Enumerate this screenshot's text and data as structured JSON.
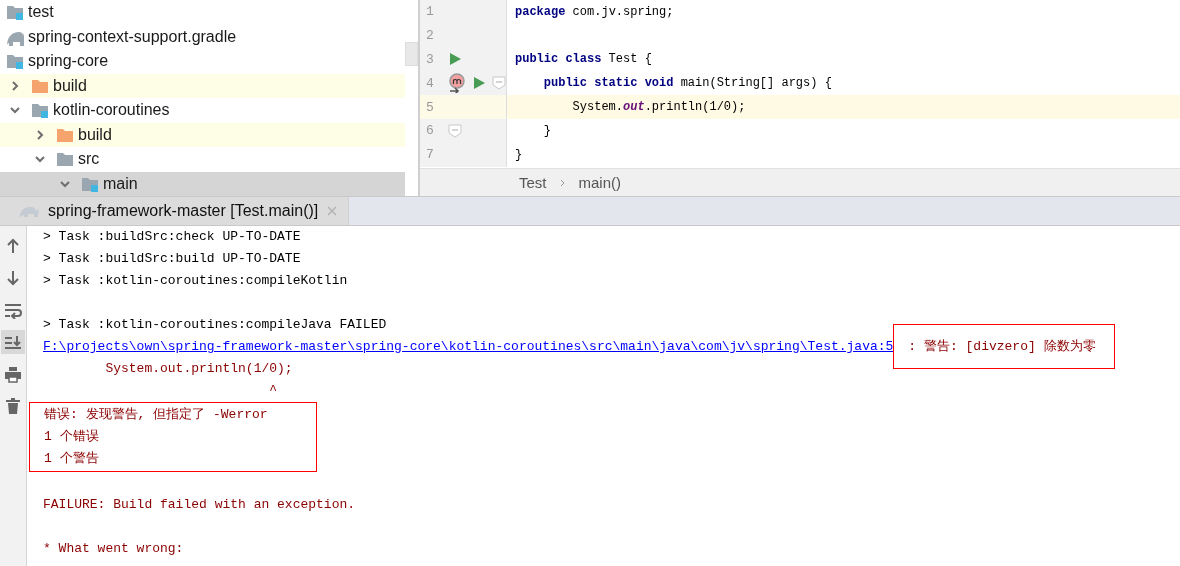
{
  "project_tree": {
    "items": [
      {
        "label": "test",
        "kind": "module"
      },
      {
        "label": "spring-context-support.gradle",
        "kind": "gradle"
      },
      {
        "label": "spring-core",
        "kind": "module",
        "children": [
          {
            "label": "build",
            "kind": "excluded",
            "expanded": false,
            "highlighted": true,
            "selected": false
          },
          {
            "label": "kotlin-coroutines",
            "kind": "module",
            "expanded": true,
            "highlighted": false,
            "selected": false,
            "children": [
              {
                "label": "build",
                "kind": "excluded",
                "expanded": false,
                "highlighted": true,
                "selected": false
              },
              {
                "label": "src",
                "kind": "folder",
                "expanded": true,
                "highlighted": false,
                "selected": false,
                "children": [
                  {
                    "label": "main",
                    "kind": "module",
                    "expanded": true,
                    "highlighted": false,
                    "selected": true
                  }
                ]
              }
            ]
          }
        ]
      }
    ]
  },
  "editor": {
    "lines": [
      {
        "number": "1",
        "code": "**package** com.jv.spring;",
        "current": false
      },
      {
        "number": "2",
        "current": false
      },
      {
        "number": "3",
        "code": "**public class** Test {",
        "current": false,
        "markers": [
          {
            "kind": "run"
          }
        ]
      },
      {
        "number": "4",
        "code": "    **public static void** main(String[] args) {",
        "current": false,
        "markers": [
          {
            "kind": "method"
          },
          {
            "kind": "run"
          },
          {
            "kind": "fold"
          }
        ]
      },
      {
        "number": "5",
        "code": "        System.*out*.println(1/0);",
        "current": true
      },
      {
        "number": "6",
        "code": "    }",
        "current": false,
        "markers": [
          {
            "kind": "fold"
          }
        ]
      },
      {
        "number": "7",
        "code": "}",
        "current": false
      }
    ],
    "breadcrumbs": [
      "Test",
      "main()"
    ]
  },
  "run_panel": {
    "tabs": [
      {
        "label": "spring-framework-master [Test.main()]",
        "selected": true
      }
    ],
    "toolbar": [
      {
        "kind": "up",
        "selected": false
      },
      {
        "kind": "down",
        "selected": false
      },
      {
        "kind": "wrap",
        "selected": false
      },
      {
        "kind": "scroll-end",
        "selected": true
      },
      {
        "kind": "print",
        "selected": false
      },
      {
        "kind": "trash",
        "selected": false
      }
    ],
    "console": [
      {
        "kind": "task",
        "text": "> Task :buildSrc:check UP-TO-DATE"
      },
      {
        "kind": "task",
        "text": "> Task :buildSrc:build UP-TO-DATE"
      },
      {
        "kind": "task",
        "text": "> Task :kotlin-coroutines:compileKotlin"
      },
      {
        "kind": "blank"
      },
      {
        "kind": "task",
        "text": "> Task :kotlin-coroutines:compileJava FAILED"
      },
      {
        "kind": "link",
        "link": "F:\\projects\\own\\spring-framework-master\\spring-core\\kotlin-coroutines\\src\\main\\java\\com\\jv\\spring\\Test.java:5",
        "text": ": 警告: [divzero] 除数为零"
      },
      {
        "kind": "error",
        "text": "        System.out.println(1/0);"
      },
      {
        "kind": "error",
        "text": "                             ^"
      },
      {
        "kind": "boxed",
        "lines": [
          "错误: 发现警告, 但指定了 -Werror",
          "1 个错误",
          "1 个警告"
        ]
      },
      {
        "kind": "blank"
      },
      {
        "kind": "error",
        "text": "FAILURE: Build failed with an exception."
      },
      {
        "kind": "blank"
      },
      {
        "kind": "error",
        "text": "* What went wrong:"
      }
    ]
  }
}
